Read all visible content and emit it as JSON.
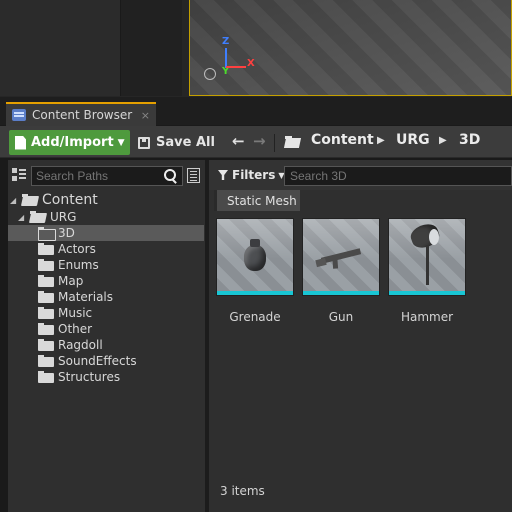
{
  "viewport": {
    "axis_z": "Z",
    "axis_y": "Y",
    "axis_x": "X",
    "gizmo_icon": "transform-gizmo-icon"
  },
  "tab": {
    "label": "Content Browser",
    "close": "×",
    "icon": "content-browser-icon"
  },
  "toolbar": {
    "add_import": "Add/Import",
    "save_all": "Save All",
    "back": "🡐",
    "forward": "🡒",
    "breadcrumbs": [
      "Content",
      "URG",
      "3D"
    ],
    "crumb_separator": "▶"
  },
  "sources": {
    "search_placeholder": "Search Paths",
    "tree": {
      "root": "Content",
      "urg": "URG",
      "folders": [
        "3D",
        "Actors",
        "Enums",
        "Map",
        "Materials",
        "Music",
        "Other",
        "Ragdoll",
        "SoundEffects",
        "Structures"
      ],
      "selected": "3D"
    }
  },
  "assets": {
    "filters_label": "Filters",
    "search_placeholder": "Search 3D",
    "active_filter": "Static Mesh",
    "items": [
      {
        "name": "Grenade"
      },
      {
        "name": "Gun"
      },
      {
        "name": "Hammer"
      }
    ],
    "count_label": "3 items",
    "accent_color": "#19c6d4"
  },
  "colors": {
    "add_button": "#4e9a3d",
    "tab_highlight": "#e5a000",
    "viewport_border": "#c4a000"
  }
}
